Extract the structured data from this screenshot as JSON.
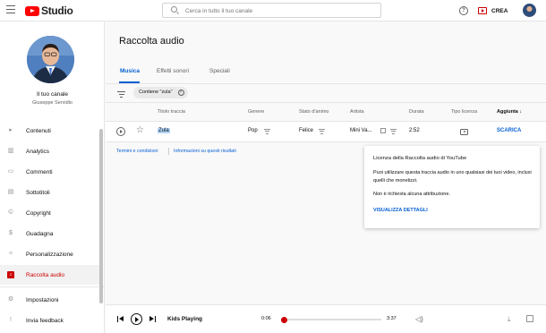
{
  "header": {
    "logo_text": "Studio",
    "search_placeholder": "Cerca in tutto il tuo canale",
    "help_label": "?",
    "create_label": "CREA"
  },
  "sidebar": {
    "channel_title": "Il tuo canale",
    "channel_name": "Giuseppe Servidio",
    "items": [
      {
        "label": "Contenuti",
        "icon": "content-icon",
        "glyph": "▸"
      },
      {
        "label": "Analytics",
        "icon": "analytics-icon",
        "glyph": "▥"
      },
      {
        "label": "Commenti",
        "icon": "comments-icon",
        "glyph": "▭"
      },
      {
        "label": "Sottotitoli",
        "icon": "subtitles-icon",
        "glyph": "▤"
      },
      {
        "label": "Copyright",
        "icon": "copyright-icon",
        "glyph": "©"
      },
      {
        "label": "Guadagna",
        "icon": "dollar-icon",
        "glyph": "$"
      },
      {
        "label": "Personalizzazione",
        "icon": "wand-icon",
        "glyph": "✧"
      },
      {
        "label": "Raccolta audio",
        "icon": "audio-library-icon",
        "glyph": "♫"
      },
      {
        "label": "Impostazioni",
        "icon": "gear-icon",
        "glyph": "⚙"
      },
      {
        "label": "Invia feedback",
        "icon": "feedback-icon",
        "glyph": "!"
      }
    ]
  },
  "main": {
    "title": "Raccolta audio",
    "tabs": [
      {
        "label": "Musica"
      },
      {
        "label": "Effetti sonori"
      },
      {
        "label": "Speciali"
      }
    ],
    "filter_chip": "Contiene \"zula\"",
    "columns": {
      "title": "Titolo traccia",
      "genre": "Genere",
      "mood": "Stato d'animo",
      "artist": "Artista",
      "duration": "Durata",
      "license": "Tipo licenza",
      "added": "Aggiunta"
    },
    "row": {
      "title": "Zula",
      "genre": "Pop",
      "mood": "Felice",
      "artist": "Mini Va...",
      "duration": "2:52",
      "download": "SCARICA"
    },
    "links": {
      "terms": "Termini e condizioni",
      "info": "Informazioni su questi risultati"
    }
  },
  "popup": {
    "title": "Licenza della Raccolta audio di YouTube",
    "body": "Puoi utilizzare questa traccia audio in uno qualsiasi dei tuoi video, inclusi quelli che monetizzi.",
    "note": "Non è richiesta alcuna attribuzione.",
    "link": "VISUALIZZA DETTAGLI"
  },
  "player": {
    "track": "Kids Playing",
    "current_time": "0:06",
    "total_time": "3:37",
    "progress": 0.03
  }
}
